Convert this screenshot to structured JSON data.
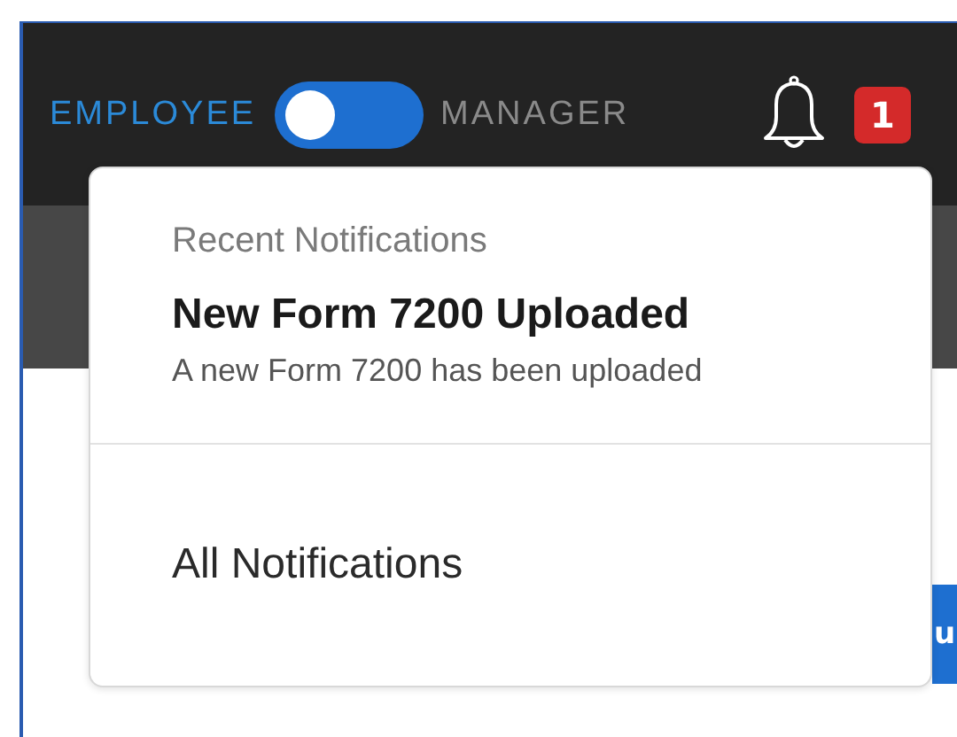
{
  "header": {
    "mode_toggle": [
      {
        "label": "EMPLOYEE",
        "selected": true
      },
      {
        "label": "MANAGER",
        "selected": false
      }
    ],
    "notification_badge": "1"
  },
  "notifications_menu": {
    "heading": "Recent Notifications",
    "items": [
      {
        "title": "New Form 7200 Uploaded",
        "description": "A new Form 7200 has been uploaded"
      }
    ],
    "footer_link": "All Notifications"
  },
  "page_button": "u"
}
